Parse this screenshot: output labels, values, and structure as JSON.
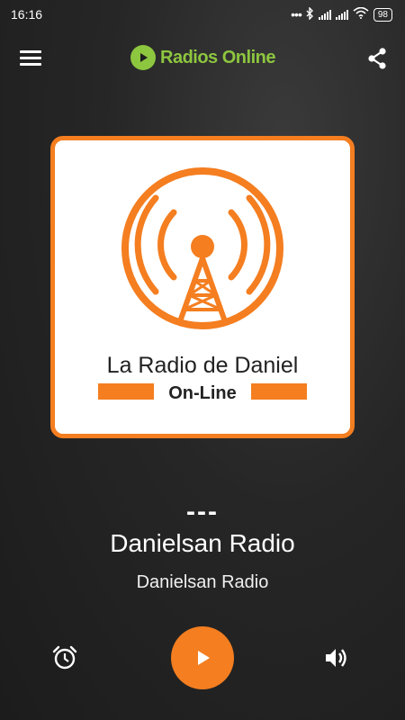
{
  "status_bar": {
    "time": "16:16",
    "battery": "98",
    "icons": [
      "more-dots-icon",
      "bluetooth-icon",
      "signal-icon",
      "signal-icon",
      "wifi-icon",
      "battery-icon"
    ]
  },
  "app_bar": {
    "logo_text": "Radios Online",
    "menu_icon": "hamburger-menu-icon",
    "share_icon": "share-icon"
  },
  "artwork": {
    "station_name": "La Radio de Daniel",
    "tagline": "On-Line",
    "icon": "radio-tower-icon"
  },
  "now_playing": {
    "current_track": "---",
    "title": "Danielsan Radio",
    "subtitle": "Danielsan Radio"
  },
  "controls": {
    "alarm_icon": "alarm-clock-icon",
    "play_icon": "play-icon",
    "volume_icon": "volume-icon"
  },
  "colors": {
    "accent": "#f47e20",
    "brand_green": "#8dc63f",
    "background": "#262626"
  }
}
